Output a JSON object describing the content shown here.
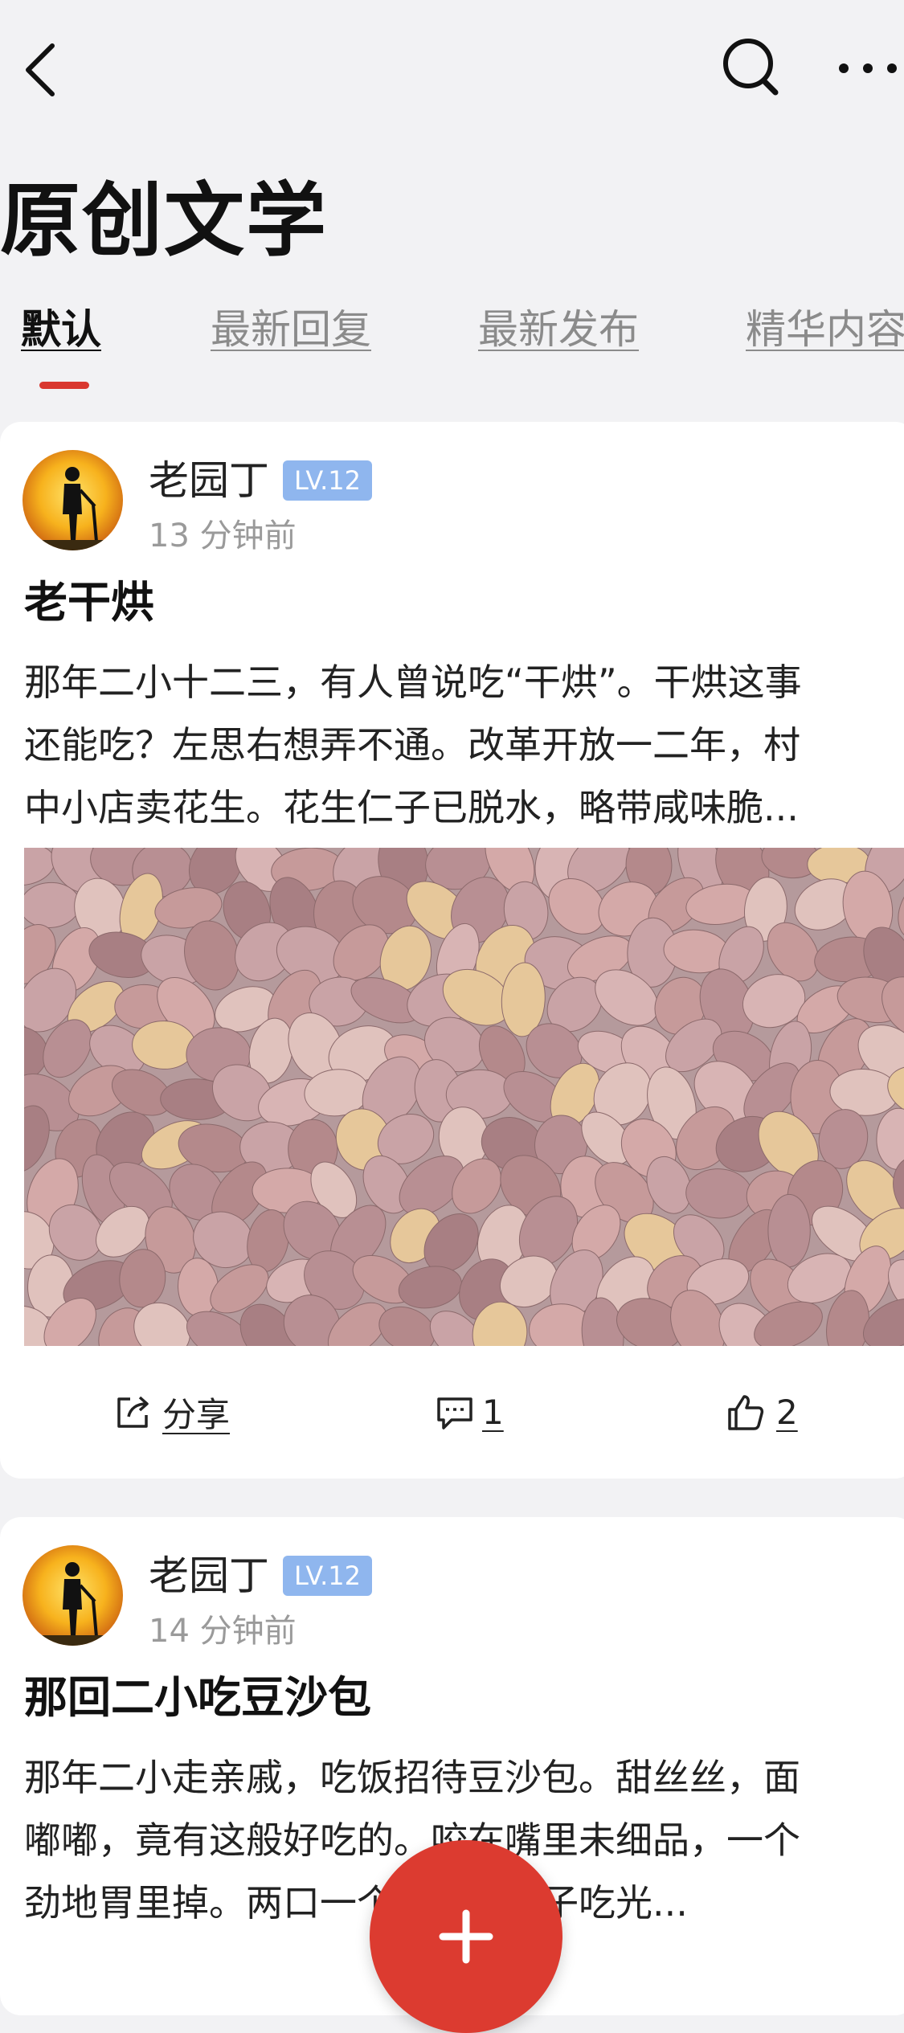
{
  "header": {
    "title": "原创文学",
    "icons": {
      "back": "chevron-left-icon",
      "search": "search-icon",
      "more": "more-horizontal-icon"
    }
  },
  "tabs": [
    {
      "label": "默认",
      "active": true
    },
    {
      "label": "最新回复",
      "active": false
    },
    {
      "label": "最新发布",
      "active": false
    },
    {
      "label": "精华内容",
      "active": false
    }
  ],
  "posts": [
    {
      "author": "老园丁",
      "level": "LV.12",
      "time": "13 分钟前",
      "title": "老干烘",
      "excerpt": [
        "那年二小十二三，有人曾说吃“干烘”。干烘这事",
        "还能吃？左思右想弄不通。改革开放一二年，村",
        "中小店卖花生。花生仁子已脱水，略带咸味脆..."
      ],
      "image": "peanuts-photo",
      "actions": {
        "share": "分享",
        "comments": "1",
        "likes": "2"
      }
    },
    {
      "author": "老园丁",
      "level": "LV.12",
      "time": "14 分钟前",
      "title": "那回二小吃豆沙包",
      "excerpt": [
        "那年二小走亲戚，吃饭招待豆沙包。甜丝丝，面",
        "嘟嘟，竟有这般好吃的。咬在嘴里未细品，一个",
        "劲地胃里掉。两口一个，两篦包子吃光..."
      ]
    }
  ],
  "fab": {
    "icon": "plus-icon"
  },
  "colors": {
    "accent": "#dc3b30",
    "level_badge": "#8fb6ee",
    "background": "#f2f2f4"
  }
}
